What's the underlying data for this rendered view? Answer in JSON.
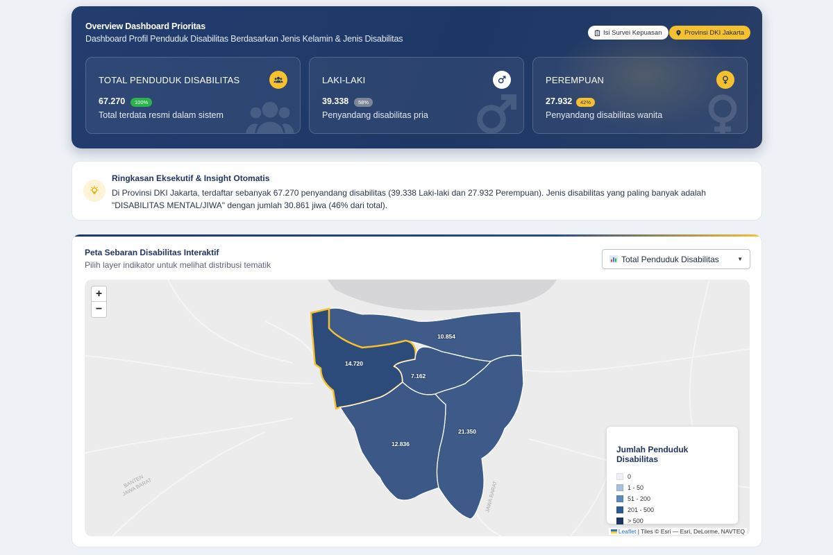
{
  "header": {
    "title": "Overview Dashboard Prioritas",
    "subtitle": "Dashboard Profil Penduduk Disabilitas Berdasarkan Jenis Kelamin & Jenis Disabilitas",
    "survey_button": "Isi Survei Kepuasan",
    "province_button": "Provinsi DKI Jakarta"
  },
  "stats": [
    {
      "label": "TOTAL PENDUDUK DISABILITAS",
      "value": "67.270",
      "badge": "100%",
      "desc": "Total terdata resmi dalam sistem",
      "icon": "users-icon",
      "icon_bg": "#f5c12e",
      "badge_bg": "#2bb24c"
    },
    {
      "label": "LAKI-LAKI",
      "value": "39.338",
      "badge": "58%",
      "desc": "Penyandang disabilitas pria",
      "icon": "male-icon",
      "icon_bg": "#ffffff",
      "badge_bg": "#7d8699"
    },
    {
      "label": "PEREMPUAN",
      "value": "27.932",
      "badge": "42%",
      "desc": "Penyandang disabilitas wanita",
      "icon": "female-icon",
      "icon_bg": "#f5c12e",
      "badge_bg": "#f5c12e"
    }
  ],
  "insight": {
    "title": "Ringkasan Eksekutif & Insight Otomatis",
    "text": "Di Provinsi DKI Jakarta, terdaftar sebanyak 67.270 penyandang disabilitas (39.338 Laki-laki dan 27.932 Perempuan). Jenis disabilitas yang paling banyak adalah \"DISABILITAS MENTAL/JIWA\" dengan jumlah 30.861 jiwa (46% dari total)."
  },
  "map": {
    "title": "Peta Sebaran Disabilitas Interaktif",
    "subtitle": "Pilih layer indikator untuk melihat distribusi tematik",
    "layer_selected": "Total Penduduk Disabilitas",
    "zoom_in": "+",
    "zoom_out": "−",
    "region_values": {
      "north": "10.854",
      "west": "14.720",
      "central": "7.162",
      "south": "12.836",
      "east": "21.350"
    },
    "legend": {
      "title": "Jumlah Penduduk Disabilitas",
      "items": [
        {
          "label": "0",
          "color": "#eef2f8"
        },
        {
          "label": "1 - 50",
          "color": "#a9c0dc"
        },
        {
          "label": "51 - 200",
          "color": "#5f88bb"
        },
        {
          "label": "201 - 500",
          "color": "#2e5b94"
        },
        {
          "label": "> 500",
          "color": "#1c3766"
        }
      ]
    },
    "attribution_link": "Leaflet",
    "attribution_text": "| Tiles © Esri — Esri, DeLorme, NAVTEQ",
    "basemap_labels": [
      "BANTEN",
      "JAWA BARAT",
      "JAWA BARAT"
    ]
  }
}
